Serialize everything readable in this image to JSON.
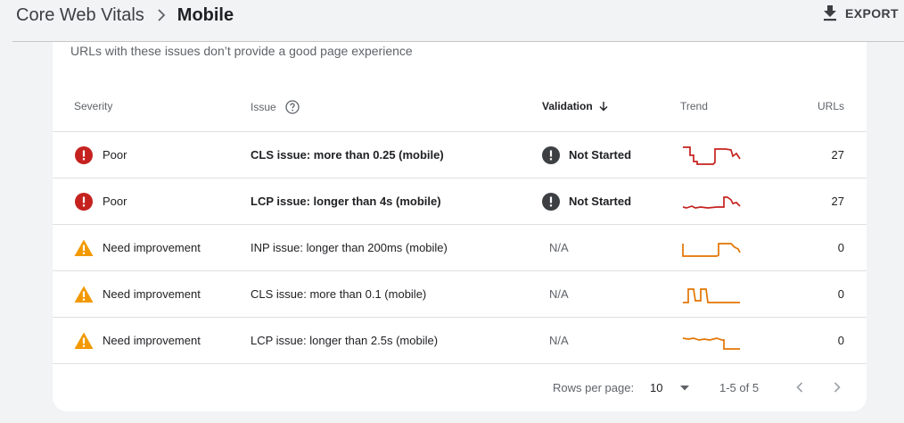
{
  "header": {
    "breadcrumb_parent": "Core Web Vitals",
    "breadcrumb_current": "Mobile",
    "export_label": "EXPORT"
  },
  "card": {
    "subtitle": "URLs with these issues don’t provide a good page experience"
  },
  "table": {
    "columns": {
      "severity": "Severity",
      "issue": "Issue",
      "validation": "Validation",
      "trend": "Trend",
      "urls": "URLs"
    },
    "rows": [
      {
        "severity": "Poor",
        "severity_level": "poor",
        "issue": "CLS issue: more than 0.25 (mobile)",
        "validation": "Not Started",
        "urls": "27",
        "trend_color": "#c5221f"
      },
      {
        "severity": "Poor",
        "severity_level": "poor",
        "issue": "LCP issue: longer than 4s (mobile)",
        "validation": "Not Started",
        "urls": "27",
        "trend_color": "#c5221f"
      },
      {
        "severity": "Need improvement",
        "severity_level": "warning",
        "issue": "INP issue: longer than 200ms (mobile)",
        "validation": "N/A",
        "urls": "0",
        "trend_color": "#e37400"
      },
      {
        "severity": "Need improvement",
        "severity_level": "warning",
        "issue": "CLS issue: more than 0.1 (mobile)",
        "validation": "N/A",
        "urls": "0",
        "trend_color": "#e37400"
      },
      {
        "severity": "Need improvement",
        "severity_level": "warning",
        "issue": "LCP issue: longer than 2.5s (mobile)",
        "validation": "N/A",
        "urls": "0",
        "trend_color": "#e37400"
      }
    ]
  },
  "pagination": {
    "rows_per_page_label": "Rows per page:",
    "rows_per_page_value": "10",
    "range": "1-5 of 5"
  },
  "colors": {
    "poor": "#c5221f",
    "warning": "#f29900",
    "validation_icon": "#3c4043"
  }
}
